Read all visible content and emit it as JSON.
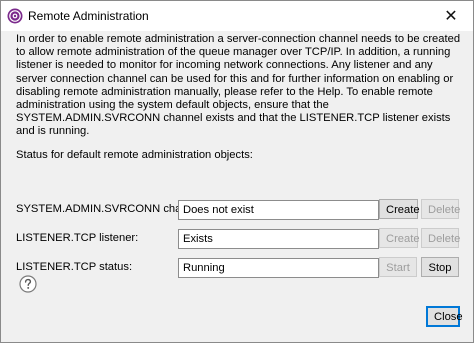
{
  "window": {
    "title": "Remote Administration",
    "app_icon": "websphere-mq-icon",
    "close_glyph": "✕"
  },
  "description": "In order to enable remote administration a server-connection channel needs to be created to allow remote administration of the queue manager over TCP/IP. In addition, a running listener is needed to monitor for incoming network connections. Any listener and any server connection channel can be used for this and for further information on enabling or disabling remote administration manually, please refer to the Help. To enable remote administration using the system default objects, ensure that the SYSTEM.ADMIN.SVRCONN channel exists and that the LISTENER.TCP listener exists and is running.",
  "status_section_label": "Status for default remote administration objects:",
  "rows": [
    {
      "label": "SYSTEM.ADMIN.SVRCONN channel:",
      "value": "Does not exist",
      "buttons": [
        {
          "label": "Create",
          "enabled": true
        },
        {
          "label": "Delete",
          "enabled": false
        }
      ]
    },
    {
      "label": "LISTENER.TCP listener:",
      "value": "Exists",
      "buttons": [
        {
          "label": "Create",
          "enabled": false
        },
        {
          "label": "Delete",
          "enabled": false
        }
      ]
    },
    {
      "label": "LISTENER.TCP status:",
      "value": "Running",
      "buttons": [
        {
          "label": "Start",
          "enabled": false
        },
        {
          "label": "Stop",
          "enabled": true
        }
      ]
    }
  ],
  "footer": {
    "help_icon": "help-icon",
    "close_label": "Close"
  },
  "colors": {
    "dialog_background": "#f0f0f0",
    "focus_border": "#0078d7",
    "disabled_text": "#9d9d9d",
    "app_icon_purple": "#7b2a8c"
  }
}
